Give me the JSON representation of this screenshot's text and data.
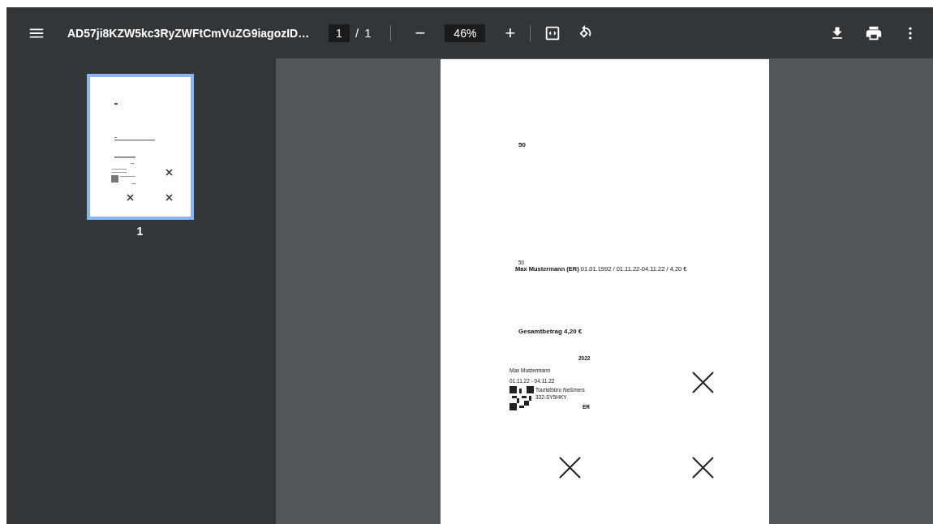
{
  "toolbar": {
    "title": "AD57ji8KZW5kc3RyZWFtCmVuZG9iagozID…",
    "page_input": "1",
    "page_separator": "/",
    "page_total": "1",
    "zoom": "46%",
    "zoom_out": "−",
    "zoom_in": "+"
  },
  "sidebar": {
    "thumbnails": [
      {
        "label": "1",
        "selected": true
      }
    ]
  },
  "document": {
    "heading": "50",
    "line_number": "50",
    "passenger_line": "**Max Mustermann (ER)** 01.01.1992 / 01.11.22-04.11.22 / 4,20 €",
    "total": "Gesamtbetrag 4,20 €",
    "ticket": {
      "year": "2022",
      "name": "Max Mustermann",
      "dates": "01.11.22 - 04.11.22",
      "issuer": "Touristbüro Neßmers",
      "code": "332-SY5HKY",
      "type": "ER"
    }
  }
}
